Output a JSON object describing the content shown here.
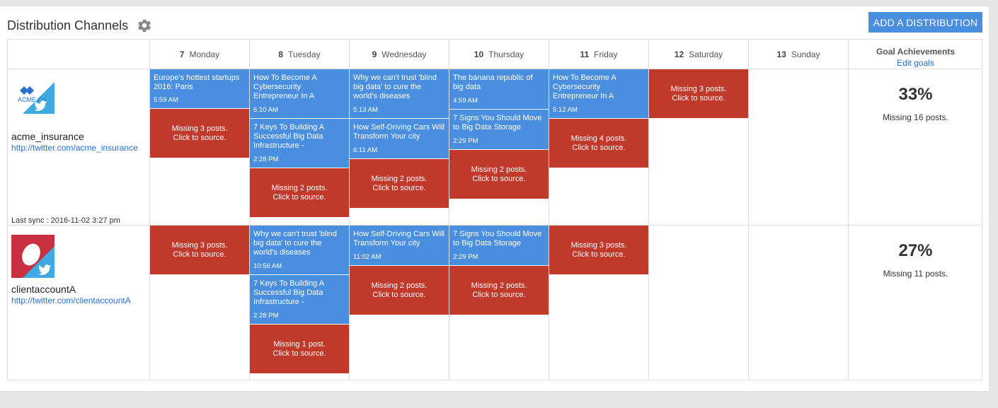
{
  "header": {
    "title": "Distribution Channels",
    "add_button": "ADD A DISTRIBUTION"
  },
  "days": [
    {
      "num": "7",
      "name": "Monday"
    },
    {
      "num": "8",
      "name": "Tuesday"
    },
    {
      "num": "9",
      "name": "Wednesday"
    },
    {
      "num": "10",
      "name": "Thursday"
    },
    {
      "num": "11",
      "name": "Friday"
    },
    {
      "num": "12",
      "name": "Saturday"
    },
    {
      "num": "13",
      "name": "Sunday"
    }
  ],
  "goals_header": {
    "title": "Goal Achievements",
    "edit": "Edit goals"
  },
  "accounts": [
    {
      "name": "acme_insurance",
      "url": "http://twitter.com/acme_insurance",
      "logo_text": "ACME Co",
      "last_sync": "Last sync : 2016-11-02 3:27 pm",
      "goal_pct": "33%",
      "goal_missing": "Missing 16 posts."
    },
    {
      "name": "clientaccountA",
      "url": "http://twitter.com/clientaccountA",
      "goal_pct": "27%",
      "goal_missing": "Missing 11 posts."
    }
  ],
  "posts": {
    "p1": {
      "title": "Europe's hottest startups 2016: Paris",
      "time": "5:59 AM"
    },
    "p2": {
      "title": "How To Become A Cybersecurity Entrepreneur In A",
      "time": "6:10 AM"
    },
    "p3": {
      "title": "7 Keys To Building A Successful Big Data Infrastructure -",
      "time": "2:28 PM"
    },
    "p4": {
      "title": "Why we can't trust 'blind big data' to cure the world's diseases",
      "time": "5:13 AM"
    },
    "p5": {
      "title": "How Self-Driving Cars Will Transform Your city",
      "time": "6:11 AM"
    },
    "p6": {
      "title": "The banana republic of big data",
      "time": "4:59 AM"
    },
    "p7": {
      "title": "7 Signs You Should Move to Big Data Storage",
      "time": "2:29 PM"
    },
    "p8": {
      "title": "How To Become A Cybersecurity Entrepreneur In A",
      "time": "5:12 AM"
    },
    "p9": {
      "title": "Why we can't trust 'blind big data' to cure the world's diseases",
      "time": "10:56 AM"
    },
    "p10": {
      "title": "7 Keys To Building A Successful Big Data Infrastructure -",
      "time": "2:28 PM"
    },
    "p11": {
      "title": "How Self-Driving Cars Will Transform Your city",
      "time": "11:02 AM"
    },
    "p12": {
      "title": "7 Signs You Should Move to Big Data Storage",
      "time": "2:29 PM"
    }
  },
  "missing": {
    "m3": "Missing 3 posts.",
    "m2": "Missing 2 posts.",
    "m4": "Missing 4 posts.",
    "m1": "Missing 1 post.",
    "click": "Click to source."
  },
  "colors": {
    "post": "#4a8ee0",
    "missing": "#c0392b",
    "accent": "#4a8ee0",
    "link": "#2a6fcb"
  }
}
